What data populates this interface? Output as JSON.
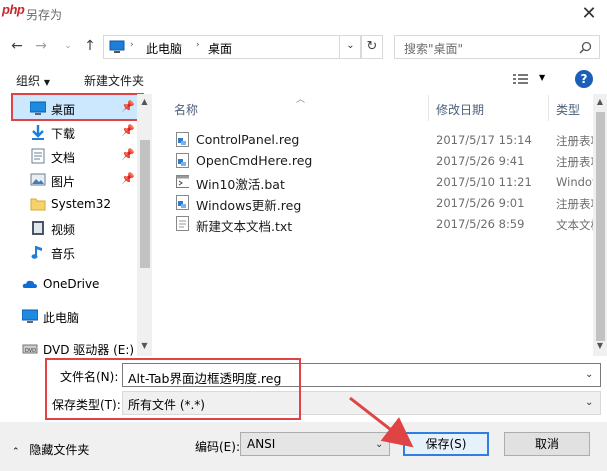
{
  "window": {
    "logo_text": "php",
    "title": "另存为",
    "close_glyph": "✕"
  },
  "nav": {
    "back": "←",
    "forward": "→",
    "up": "↑",
    "breadcrumb": [
      "此电脑",
      "桌面"
    ],
    "search_placeholder": "搜索\"桌面\""
  },
  "toolbar": {
    "organize": "组织",
    "new_folder": "新建文件夹",
    "help": "?"
  },
  "sidebar": {
    "items": [
      {
        "label": "桌面",
        "icon": "desktop-icon",
        "pinned": true,
        "selected": true
      },
      {
        "label": "下载",
        "icon": "download-icon",
        "pinned": true
      },
      {
        "label": "文档",
        "icon": "documents-icon",
        "pinned": true
      },
      {
        "label": "图片",
        "icon": "pictures-icon",
        "pinned": true
      },
      {
        "label": "System32",
        "icon": "folder-icon"
      },
      {
        "label": "视频",
        "icon": "videos-icon"
      },
      {
        "label": "音乐",
        "icon": "music-icon"
      },
      {
        "label": "OneDrive",
        "icon": "onedrive-icon"
      },
      {
        "label": "此电脑",
        "icon": "computer-icon"
      },
      {
        "label": "DVD 驱动器 (E:) C",
        "icon": "dvd-icon"
      }
    ]
  },
  "file_list": {
    "columns": [
      "名称",
      "修改日期",
      "类型"
    ],
    "rows": [
      {
        "name": "ControlPanel.reg",
        "date": "2017/5/17 15:14",
        "type": "注册表项",
        "icon": "reg-file-icon"
      },
      {
        "name": "OpenCmdHere.reg",
        "date": "2017/5/26 9:41",
        "type": "注册表项",
        "icon": "reg-file-icon"
      },
      {
        "name": "Win10激活.bat",
        "date": "2017/5/10 11:21",
        "type": "Windows",
        "icon": "bat-file-icon"
      },
      {
        "name": "Windows更新.reg",
        "date": "2017/5/26 9:01",
        "type": "注册表项",
        "icon": "reg-file-icon"
      },
      {
        "name": "新建文本文档.txt",
        "date": "2017/5/26 8:59",
        "type": "文本文档",
        "icon": "txt-file-icon"
      }
    ]
  },
  "save_fields": {
    "filename_label": "文件名(N):",
    "filename_value": "Alt-Tab界面边框透明度.reg",
    "filetype_label": "保存类型(T):",
    "filetype_value": "所有文件  (*.*)"
  },
  "footer": {
    "hide_folders": "隐藏文件夹",
    "encoding_label": "编码(E):",
    "encoding_value": "ANSI",
    "save": "保存(S)",
    "cancel": "取消"
  },
  "colors": {
    "highlight_red": "#e04343",
    "accent_blue": "#2f7ee0",
    "selection": "#cce8ff"
  }
}
